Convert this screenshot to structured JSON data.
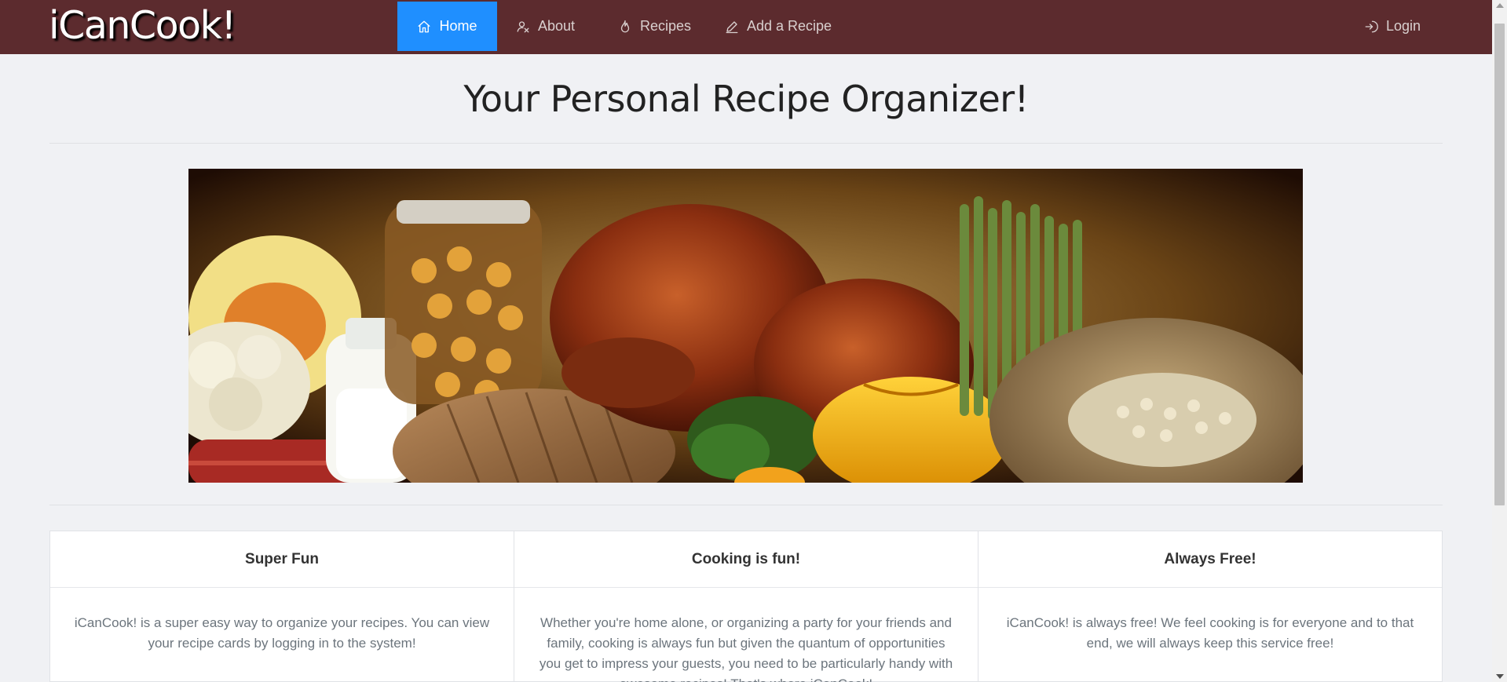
{
  "brand": "iCanCook!",
  "nav": {
    "home": "Home",
    "about": "About",
    "recipes": "Recipes",
    "add_recipe": "Add a Recipe",
    "login": "Login"
  },
  "headline": "Your Personal Recipe Organizer!",
  "cards": [
    {
      "title": "Super Fun",
      "body": "iCanCook! is a super easy way to organize your recipes. You can view your recipe cards by logging in to the system!"
    },
    {
      "title": "Cooking is fun!",
      "body": "Whether you're home alone, or organizing a party for your friends and family, cooking is always fun but given the quantum of opportunities you get to impress your guests, you need to be particularly handy with awesome recipes! That's where iCanCook!"
    },
    {
      "title": "Always Free!",
      "body": "iCanCook! is always free! We feel cooking is for everyone and to that end, we will always keep this service free!"
    }
  ],
  "colors": {
    "navbar": "#5c2b2e",
    "active_nav": "#1f8fff",
    "page_bg": "#f0f1f4"
  },
  "icons": {
    "home": "home-icon",
    "about": "user-icon",
    "recipes": "flame-icon",
    "add_recipe": "pencil-icon",
    "login": "login-icon"
  }
}
